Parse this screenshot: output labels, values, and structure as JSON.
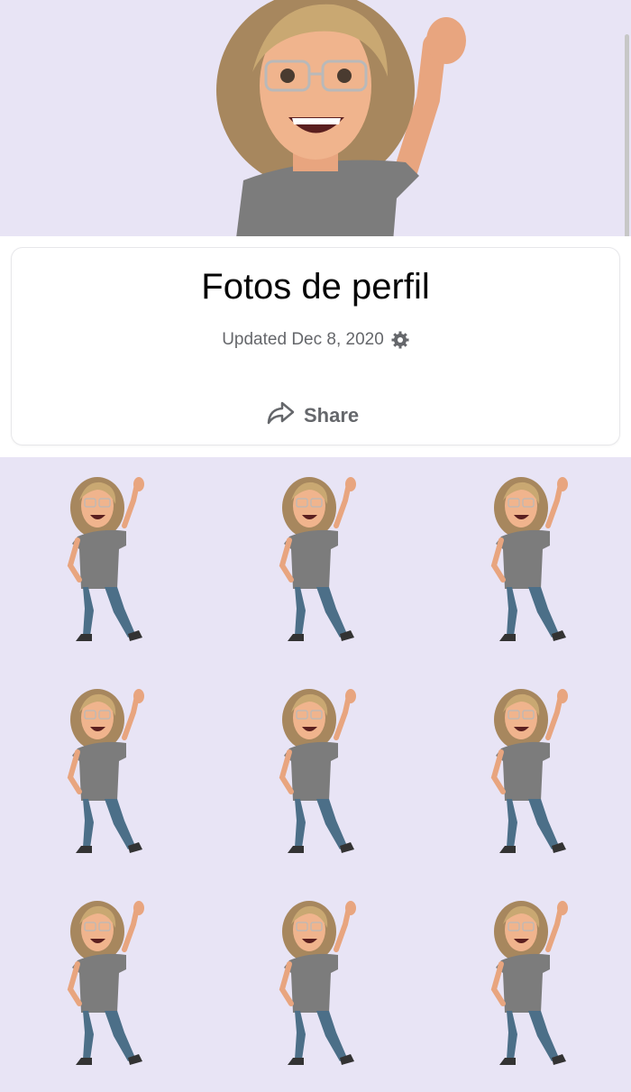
{
  "album": {
    "title": "Fotos de perfil",
    "updated": "Updated Dec 8, 2020",
    "share_label": "Share"
  },
  "icons": {
    "settings": "gear-icon",
    "share": "share-arrow-icon"
  },
  "colors": {
    "background": "#e8e4f5",
    "card": "#ffffff",
    "text_primary": "#050505",
    "text_secondary": "#65676b"
  },
  "photos": [
    {
      "alt": "avatar"
    },
    {
      "alt": "avatar"
    },
    {
      "alt": "avatar"
    },
    {
      "alt": "avatar"
    },
    {
      "alt": "avatar"
    },
    {
      "alt": "avatar"
    },
    {
      "alt": "avatar"
    },
    {
      "alt": "avatar"
    },
    {
      "alt": "avatar"
    }
  ]
}
